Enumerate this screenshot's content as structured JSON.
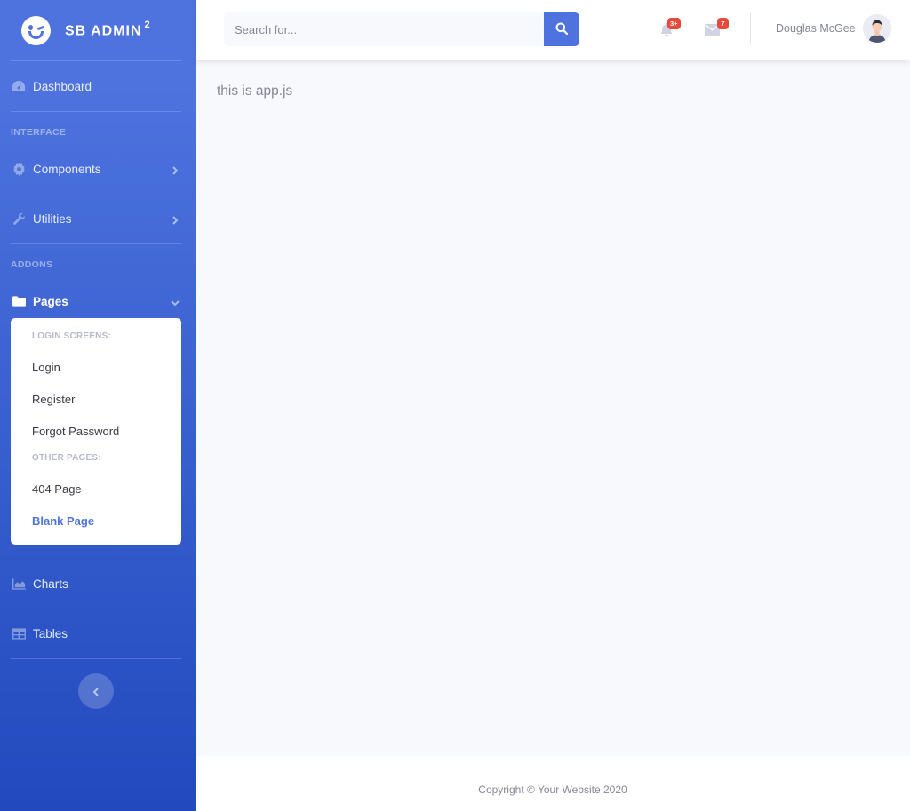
{
  "brand": {
    "name": "SB ADMIN",
    "sup": "2"
  },
  "sidebar": {
    "dashboard": "Dashboard",
    "heading_interface": "INTERFACE",
    "components": "Components",
    "utilities": "Utilities",
    "heading_addons": "ADDONS",
    "pages": "Pages",
    "charts": "Charts",
    "tables": "Tables",
    "pages_menu": {
      "header_login": "LOGIN SCREENS:",
      "login": "Login",
      "register": "Register",
      "forgot": "Forgot Password",
      "header_other": "OTHER PAGES:",
      "page404": "404 Page",
      "blank": "Blank Page"
    }
  },
  "topbar": {
    "search_placeholder": "Search for...",
    "alerts_badge": "3+",
    "messages_badge": "7",
    "user_name": "Douglas McGee"
  },
  "main": {
    "text": "this is app.js"
  },
  "footer": {
    "copyright": "Copyright © Your Website 2020"
  },
  "colors": {
    "primary": "#4e73df",
    "primary_dark": "#224abe",
    "danger": "#e74a3b",
    "bg": "#f8f9fc"
  }
}
